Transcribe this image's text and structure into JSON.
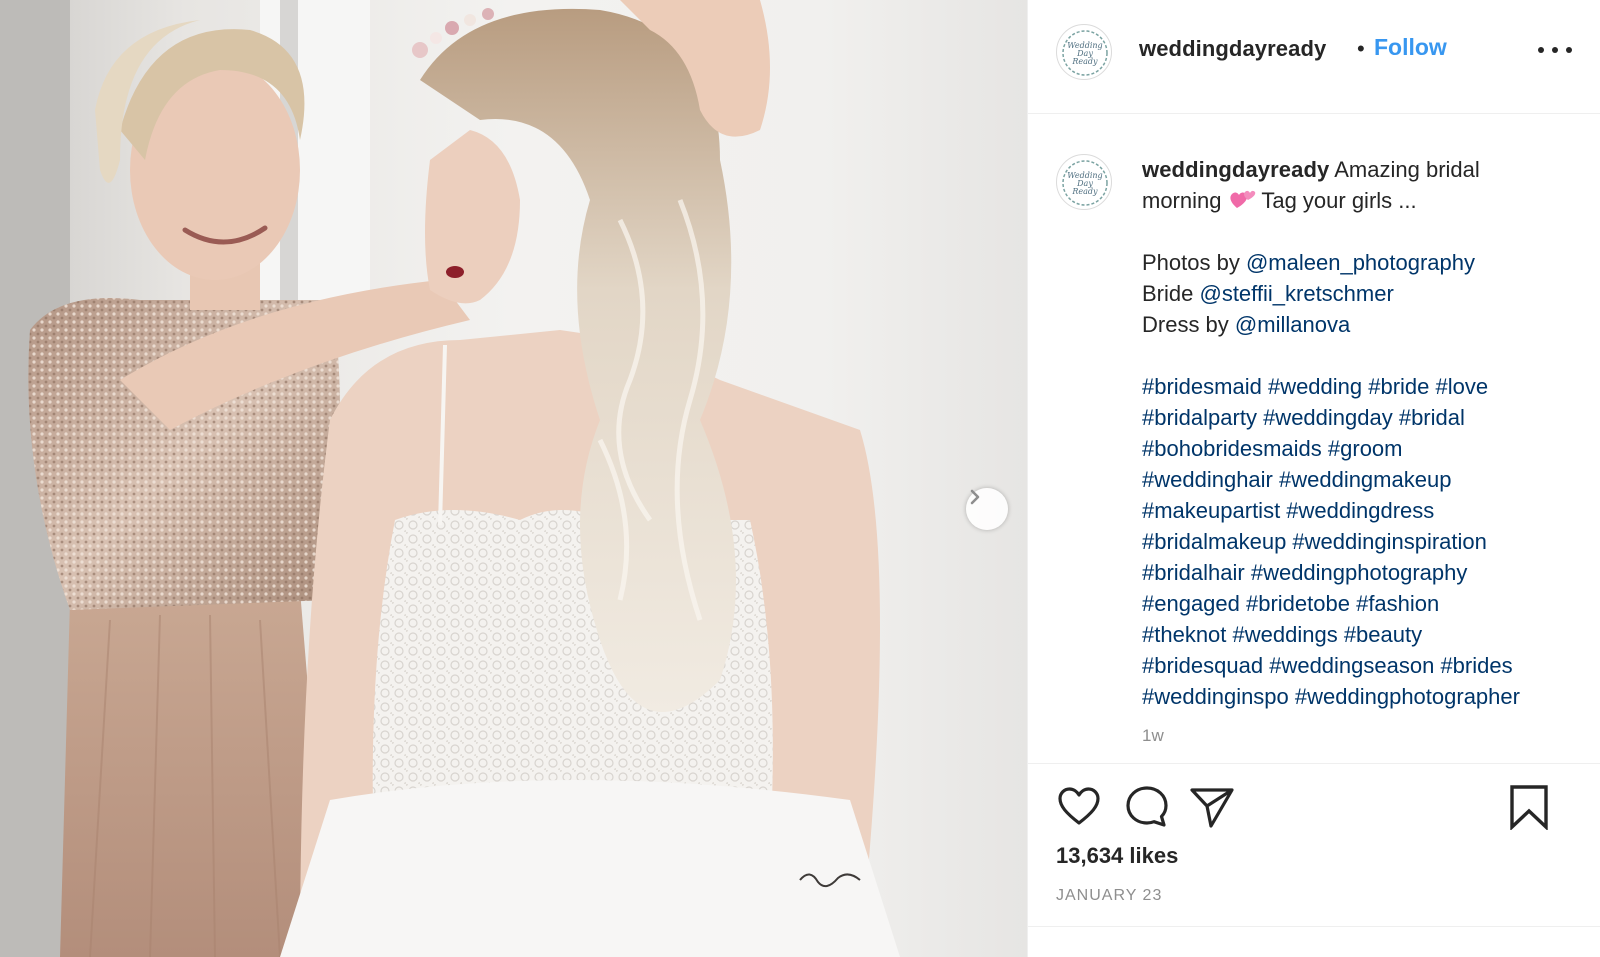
{
  "post": {
    "username": "weddingdayready",
    "separator": "•",
    "follow_label": "Follow",
    "more_icon": "more-options-icon",
    "next_icon": "chevron-right-icon",
    "photo_description_icon": "photo",
    "caption": {
      "username": "weddingdayready",
      "text_line1": "Amazing bridal",
      "text_line2_before": "morning",
      "text_line2_after": "Tag your girls ...",
      "emoji_icon": "two-hearts-emoji",
      "photos_label": "Photos by",
      "photos_handle": "@maleen_photography",
      "bride_label": "Bride",
      "bride_handle": "@steffii_kretschmer",
      "dress_label": "Dress by",
      "dress_handle": "@millanova",
      "hashtag_lines": [
        "#bridesmaid #wedding #bride #love",
        "#bridalparty #weddingday #bridal",
        "#bohobridesmaids #groom",
        "#weddinghair #weddingmakeup",
        "#makeupartist #weddingdress",
        "#bridalmakeup #weddinginspiration",
        "#bridalhair #weddingphotography",
        "#engaged #bridetobe #fashion",
        "#theknot #weddings #beauty",
        "#bridesquad #weddingseason #brides",
        "#weddinginspo #weddingphotographer"
      ]
    },
    "timestamp": "1w",
    "likes": "13,634 likes",
    "date": "JANUARY 23",
    "colors": {
      "follow_blue": "#3897f0",
      "link_navy": "#003569",
      "text": "#262626",
      "muted": "#8e8e8e",
      "divider": "#efefef"
    }
  }
}
